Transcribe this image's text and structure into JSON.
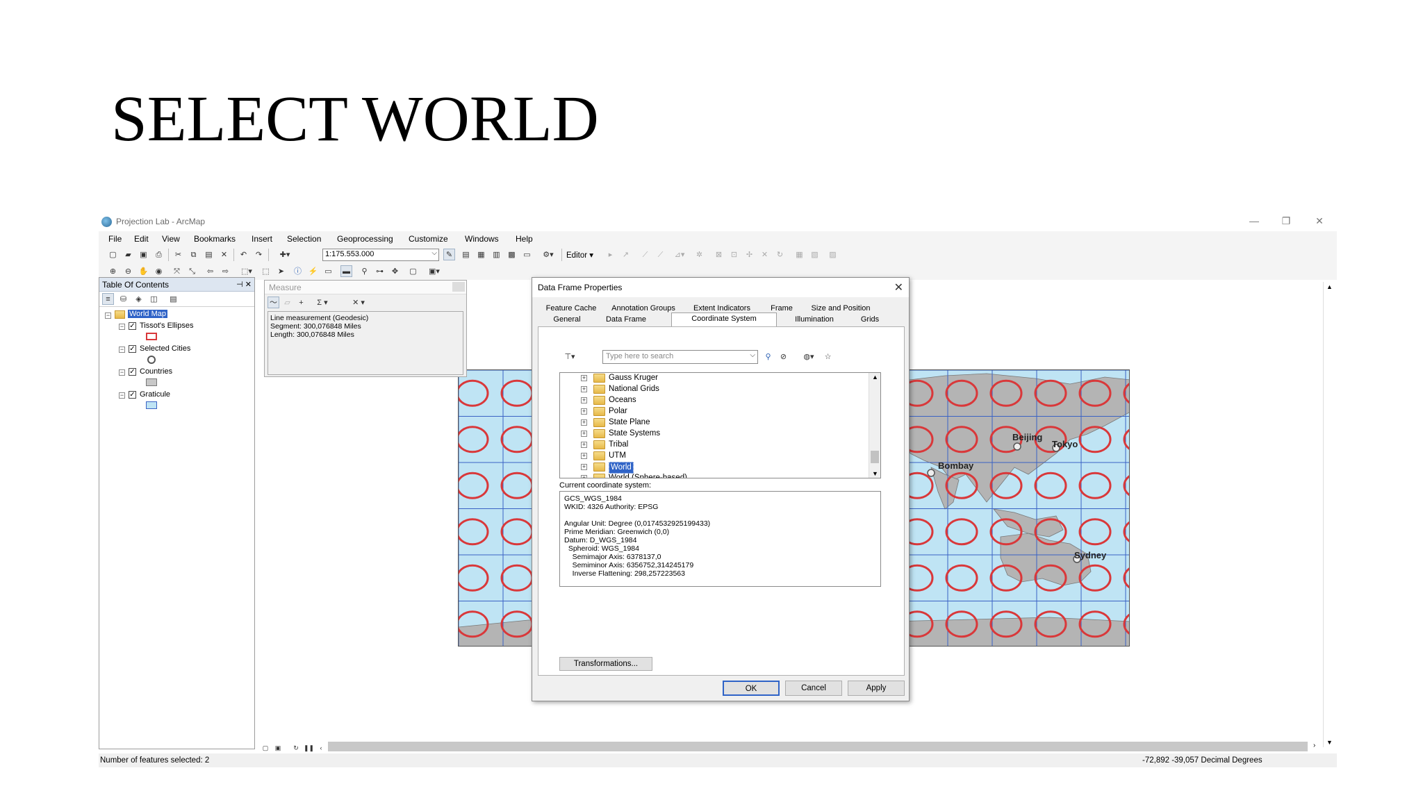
{
  "slide": {
    "title": "SELECT WORLD"
  },
  "app": {
    "title": "Projection Lab - ArcMap",
    "menu": [
      "File",
      "Edit",
      "View",
      "Bookmarks",
      "Insert",
      "Selection",
      "Geoprocessing",
      "Customize",
      "Windows",
      "Help"
    ],
    "scale": "1:175.553.000",
    "editor_label": "Editor ▾",
    "window_controls": {
      "minimize": "—",
      "restore": "❐",
      "close": "✕"
    }
  },
  "toc": {
    "title": "Table Of Contents",
    "pin": "⊣ ✕",
    "root": "World Map",
    "layers": [
      {
        "name": "Tissot's Ellipses",
        "checked": true
      },
      {
        "name": "Selected Cities",
        "checked": true
      },
      {
        "name": "Countries",
        "checked": true
      },
      {
        "name": "Graticule",
        "checked": true
      }
    ]
  },
  "measure": {
    "title": "Measure",
    "lines": [
      "Line measurement (Geodesic)",
      "Segment: 300,076848 Miles",
      "Length: 300,076848 Miles"
    ]
  },
  "map": {
    "cities": [
      "Beijing",
      "Tokyo",
      "Bombay",
      "Sydney"
    ],
    "colors": {
      "ocean": "#bfe4f4",
      "land": "#b4b4b4",
      "ellipse": "#d9383a",
      "grid": "#3a62c4"
    }
  },
  "dialog": {
    "title": "Data Frame Properties",
    "tabs_row1": [
      "Feature Cache",
      "Annotation Groups",
      "Extent Indicators",
      "Frame",
      "Size and Position"
    ],
    "tabs_row2": [
      "General",
      "Data Frame",
      "Coordinate System",
      "Illumination",
      "Grids"
    ],
    "active_tab": "Coordinate System",
    "search_placeholder": "Type here to search",
    "tree": [
      "Gauss Kruger",
      "National Grids",
      "Oceans",
      "Polar",
      "State Plane",
      "State Systems",
      "Tribal",
      "UTM",
      "World",
      "World (Sphere-based)"
    ],
    "selected_item": "World",
    "current_label": "Current coordinate system:",
    "current_lines": [
      "GCS_WGS_1984",
      "WKID: 4326 Authority: EPSG",
      "",
      "Angular Unit: Degree (0,0174532925199433)",
      "Prime Meridian: Greenwich (0,0)",
      "Datum: D_WGS_1984",
      "  Spheroid: WGS_1984",
      "    Semimajor Axis: 6378137,0",
      "    Semiminor Axis: 6356752,314245179",
      "    Inverse Flattening: 298,257223563"
    ],
    "transformations_label": "Transformations...",
    "ok_label": "OK",
    "cancel_label": "Cancel",
    "apply_label": "Apply"
  },
  "status": {
    "left": "Number of features selected: 2",
    "right": "-72,892  -39,057 Decimal Degrees"
  }
}
